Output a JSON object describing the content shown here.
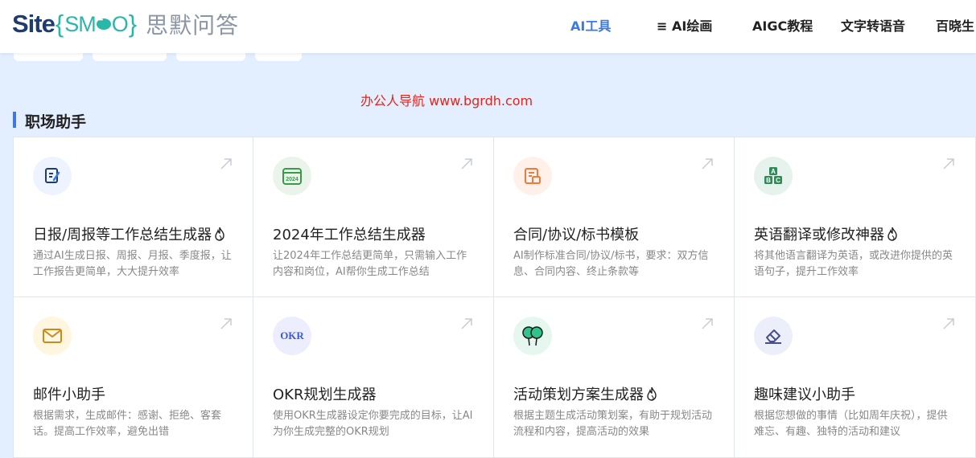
{
  "header": {
    "logo": {
      "site": "Site",
      "brace_open": "{",
      "smo_s": "S",
      "smo_o": "O",
      "brace_close": "}",
      "cn_name": "思默问答"
    },
    "nav": [
      {
        "label": "AI工具",
        "active": true
      },
      {
        "label": "≡ AI绘画",
        "active": false
      },
      {
        "label": "AIGC教程",
        "active": false
      },
      {
        "label": "文字转语音",
        "active": false
      },
      {
        "label": "百晓生",
        "active": false
      }
    ]
  },
  "watermark": "办公人导航 www.bgrdh.com",
  "section": {
    "title": "职场助手"
  },
  "cards": [
    {
      "title": "日报/周报等工作总结生成器",
      "hot": true,
      "icon": "edit-icon",
      "icon_color": "#1e3d6e",
      "icon_bg": "#eef4ff",
      "desc": "通过AI生成日报、周报、月报、季度报，让工作报告更简单，大大提升效率"
    },
    {
      "title": "2024年工作总结生成器",
      "hot": false,
      "icon": "calendar-2024-icon",
      "icon_color": "#3a9a4a",
      "icon_bg": "#eaf4ea",
      "icon_text": "2024",
      "desc": "让2024年工作总结更简单，只需输入工作内容和岗位，AI帮你生成工作总结"
    },
    {
      "title": "合同/协议/标书模板",
      "hot": false,
      "icon": "contract-icon",
      "icon_color": "#f07a3a",
      "icon_bg": "#fff1ea",
      "desc": "AI制作标准合同/协议/标书，要求：双方信息、合同内容、终止条款等"
    },
    {
      "title": "英语翻译或修改神器",
      "hot": true,
      "icon": "abc-blocks-icon",
      "icon_color": "#2e8b57",
      "icon_bg": "#e6f3ec",
      "icon_letters": [
        "A",
        "B",
        "C"
      ],
      "desc": "将其他语言翻译为英语，或改进你提供的英语句子，提升工作效率"
    },
    {
      "title": "邮件小助手",
      "hot": false,
      "icon": "envelope-icon",
      "icon_color": "#c98a1e",
      "icon_bg": "#fff6e0",
      "desc": "根据需求，生成邮件：感谢、拒绝、客套话。提高工作效率，避免出错"
    },
    {
      "title": "OKR规划生成器",
      "hot": false,
      "icon": "okr-icon",
      "icon_color": "#3b5bd6",
      "icon_bg": "#eceefe",
      "icon_text": "OKR",
      "desc": "使用OKR生成器设定你要完成的目标，让AI为你生成完整的OKR规划"
    },
    {
      "title": "活动策划方案生成器",
      "hot": true,
      "icon": "balloons-icon",
      "icon_color": "#1f9d6a",
      "icon_bg": "#e6f7ef",
      "desc": "根据主题生成活动策划案，有助于规划活动流程和内容，提高活动的效果"
    },
    {
      "title": "趣味建议小助手",
      "hot": false,
      "icon": "eraser-icon",
      "icon_color": "#4a4f8a",
      "icon_bg": "#eceefa",
      "desc": "根据您想做的事情（比如周年庆祝），提供难忘、有趣、独特的活动和建议"
    }
  ]
}
